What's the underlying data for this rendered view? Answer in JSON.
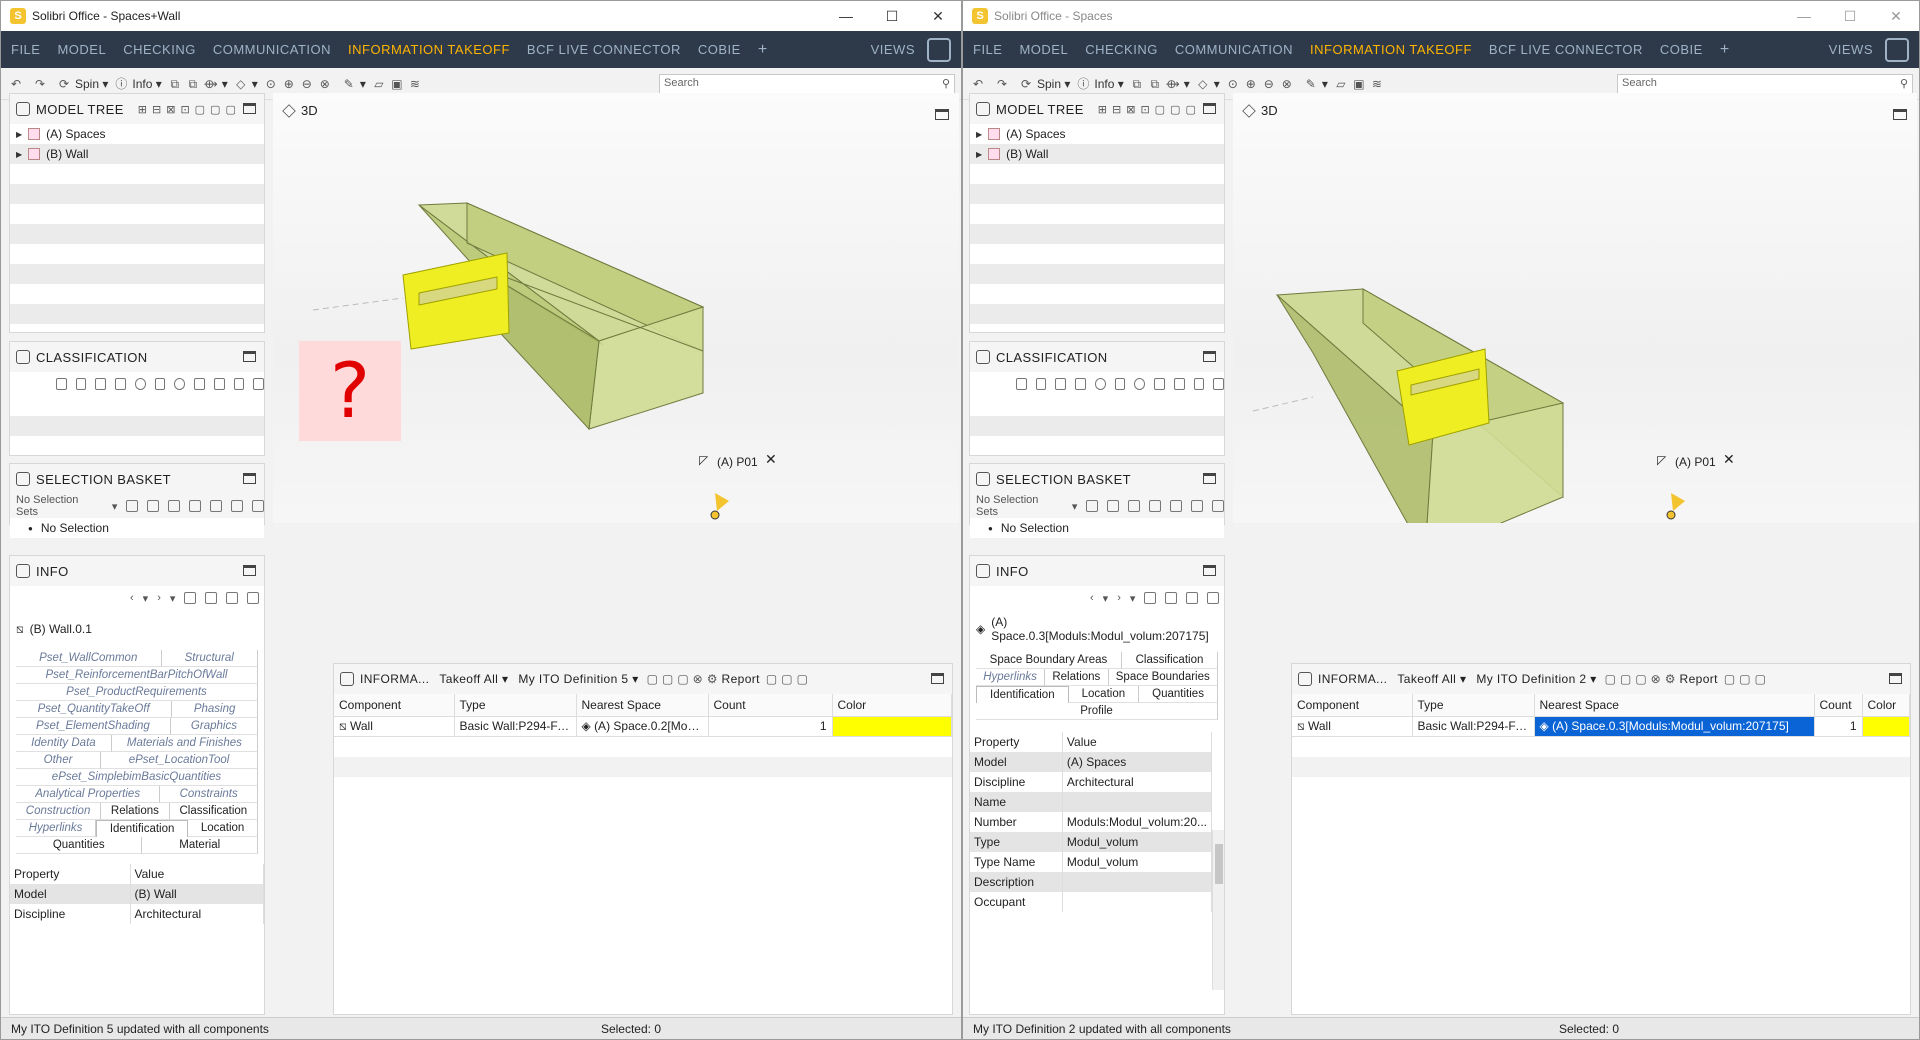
{
  "left": {
    "title": "Solibri Office - Spaces+Wall",
    "menu": [
      "FILE",
      "MODEL",
      "CHECKING",
      "COMMUNICATION",
      "INFORMATION TAKEOFF",
      "BCF LIVE CONNECTOR",
      "COBIE"
    ],
    "menu_active_index": 4,
    "views_label": "VIEWS",
    "toolbar": {
      "spin": "Spin",
      "info": "Info",
      "search_placeholder": "Search"
    },
    "model_tree": {
      "title": "MODEL TREE",
      "items": [
        "(A) Spaces",
        "(B) Wall"
      ]
    },
    "classification": {
      "title": "CLASSIFICATION"
    },
    "selection_basket": {
      "title": "SELECTION BASKET",
      "sets": "No Selection Sets",
      "item": "No Selection"
    },
    "view3d": {
      "title": "3D",
      "question_mark": "?",
      "tag": "(A) P01"
    },
    "info": {
      "title": "INFO",
      "selected": "(B) Wall.0.1",
      "tabs_row1": [
        "Pset_WallCommon",
        "Structural"
      ],
      "tabs_row2": [
        "Pset_ReinforcementBarPitchOfWall"
      ],
      "tabs_row3": [
        "Pset_ProductRequirements",
        "Pset_QuantityTakeOff"
      ],
      "tabs_row4": [
        "Phasing",
        "Pset_ElementShading"
      ],
      "tabs_row5": [
        "Graphics",
        "Identity Data",
        "Materials and Finishes",
        "Other"
      ],
      "tabs_row6": [
        "ePset_LocationTool",
        "ePset_SimplebimBasicQuantities"
      ],
      "tabs_row7": [
        "Analytical Properties",
        "Constraints",
        "Construction"
      ],
      "tabs_row8": [
        "Relations",
        "Classification",
        "Hyperlinks"
      ],
      "tabs_row9": [
        "Identification",
        "Location",
        "Quantities",
        "Material"
      ],
      "prop_header": [
        "Property",
        "Value"
      ],
      "props": [
        [
          "Model",
          "(B) Wall"
        ],
        [
          "Discipline",
          "Architectural"
        ]
      ]
    },
    "ito": {
      "title": "INFORMA...",
      "takeoff": "Takeoff All",
      "definition": "My ITO Definition 5",
      "report": "Report",
      "columns": [
        "Component",
        "Type",
        "Nearest Space",
        "Count",
        "Color"
      ],
      "row": {
        "component": "Wall",
        "type": "Basic Wall:P294-FAC...",
        "nearest": "(A) Space.0.2[Mod...",
        "count": "1"
      },
      "color": "#ffff00"
    },
    "status": {
      "message": "My ITO Definition 5 updated with all components",
      "selected": "Selected: 0"
    }
  },
  "right": {
    "title": "Solibri Office - Spaces",
    "menu": [
      "FILE",
      "MODEL",
      "CHECKING",
      "COMMUNICATION",
      "INFORMATION TAKEOFF",
      "BCF LIVE CONNECTOR",
      "COBIE"
    ],
    "views_label": "VIEWS",
    "toolbar": {
      "spin": "Spin",
      "info": "Info",
      "search_placeholder": "Search"
    },
    "model_tree": {
      "title": "MODEL TREE",
      "items": [
        "(A) Spaces",
        "(B) Wall"
      ]
    },
    "classification": {
      "title": "CLASSIFICATION"
    },
    "selection_basket": {
      "title": "SELECTION BASKET",
      "sets": "No Selection Sets",
      "item": "No Selection"
    },
    "view3d": {
      "title": "3D",
      "tag": "(A) P01"
    },
    "info": {
      "title": "INFO",
      "selected": "(A) Space.0.3[Moduls:Modul_volum:207175]",
      "tabs_row1": [
        "Space Boundary Areas",
        "Classification",
        "Hyperlinks"
      ],
      "tabs_row2": [
        "Relations",
        "Space Boundaries"
      ],
      "tabs_row3": [
        "Identification",
        "Location",
        "Quantities",
        "Profile"
      ],
      "prop_header": [
        "Property",
        "Value"
      ],
      "props": [
        [
          "Model",
          "(A) Spaces"
        ],
        [
          "Discipline",
          "Architectural"
        ],
        [
          "Name",
          ""
        ],
        [
          "Number",
          "Moduls:Modul_volum:20..."
        ],
        [
          "Type",
          "Modul_volum"
        ],
        [
          "Type Name",
          "Modul_volum"
        ],
        [
          "Description",
          ""
        ],
        [
          "Occupant",
          ""
        ]
      ]
    },
    "ito": {
      "title": "INFORMA...",
      "takeoff": "Takeoff All",
      "definition": "My ITO Definition 2",
      "report": "Report",
      "columns": [
        "Component",
        "Type",
        "Nearest Space",
        "Count",
        "Color"
      ],
      "row": {
        "component": "Wall",
        "type": "Basic Wall:P294-FAC...",
        "nearest": "(A) Space.0.3[Moduls:Modul_volum:207175]",
        "count": "1"
      },
      "color": "#ffff00"
    },
    "status": {
      "message": "My ITO Definition 2 updated with all components",
      "selected": "Selected: 0"
    }
  }
}
